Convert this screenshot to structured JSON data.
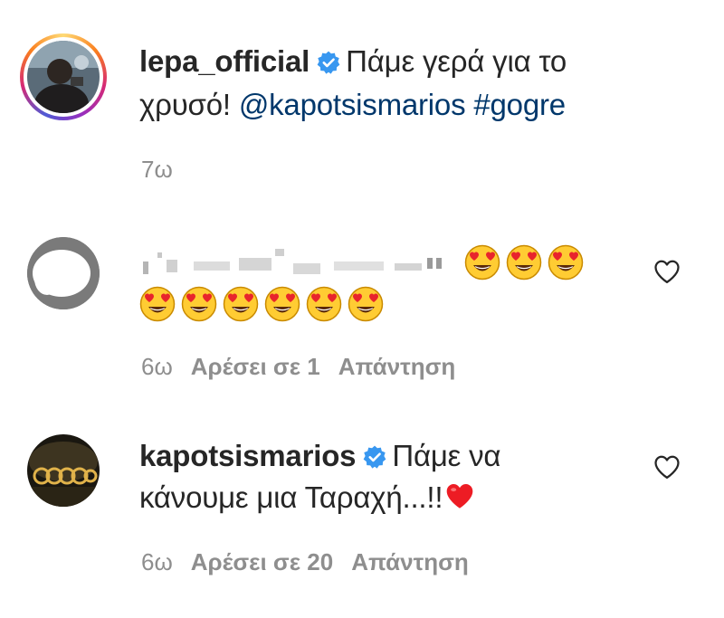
{
  "comments": [
    {
      "username": "lepa_official",
      "verified": true,
      "text_line1": "Πάμε γερά για το",
      "text_line2_prefix": "χρυσό!",
      "mention": "@kapotsismarios",
      "hashtag": "#gogre",
      "time": "7ω"
    },
    {
      "username": "",
      "emoji_line1_count": 3,
      "emoji_line2_count": 6,
      "emoji_name": "heart-eyes-emoji",
      "time": "6ω",
      "likes": "Αρέσει σε 1",
      "reply": "Απάντηση"
    },
    {
      "username": "kapotsismarios",
      "verified": true,
      "text_line1": "Πάμε να",
      "text_line2": "κάνουμε μια Ταραχή...!!",
      "time": "6ω",
      "likes": "Αρέσει σε 20",
      "reply": "Απάντηση"
    }
  ],
  "colors": {
    "link": "#00376b",
    "meta": "#8e8e8e",
    "verified": "#3897f0",
    "heart_red": "#ed1c24"
  }
}
